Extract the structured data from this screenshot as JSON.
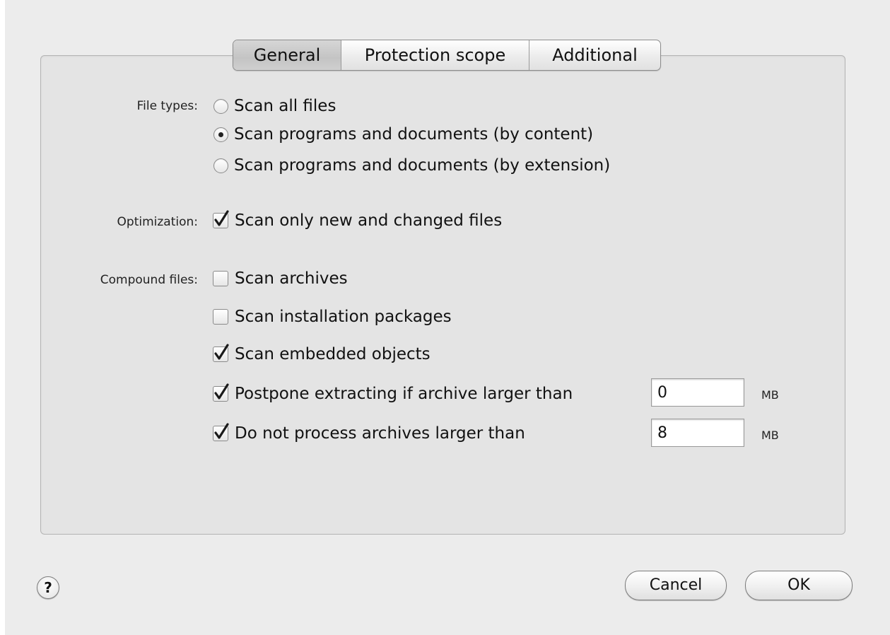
{
  "tabs": [
    {
      "label": "General",
      "selected": true
    },
    {
      "label": "Protection scope",
      "selected": false
    },
    {
      "label": "Additional",
      "selected": false
    }
  ],
  "file_types": {
    "label": "File types:",
    "options": [
      {
        "label": "Scan all files",
        "selected": false
      },
      {
        "label": "Scan programs and documents (by content)",
        "selected": true
      },
      {
        "label": "Scan programs and documents (by extension)",
        "selected": false
      }
    ]
  },
  "optimization": {
    "label": "Optimization:",
    "options": [
      {
        "label": "Scan only new and changed files",
        "checked": true
      }
    ]
  },
  "compound_files": {
    "label": "Compound files:",
    "options": [
      {
        "label": "Scan archives",
        "checked": false
      },
      {
        "label": "Scan installation packages",
        "checked": false
      },
      {
        "label": "Scan embedded objects",
        "checked": true
      },
      {
        "label": "Postpone extracting if archive larger than",
        "checked": true,
        "value": "0",
        "unit": "MB"
      },
      {
        "label": "Do not process archives larger than",
        "checked": true,
        "value": "8",
        "unit": "MB"
      }
    ]
  },
  "buttons": {
    "help": "?",
    "cancel": "Cancel",
    "ok": "OK"
  }
}
